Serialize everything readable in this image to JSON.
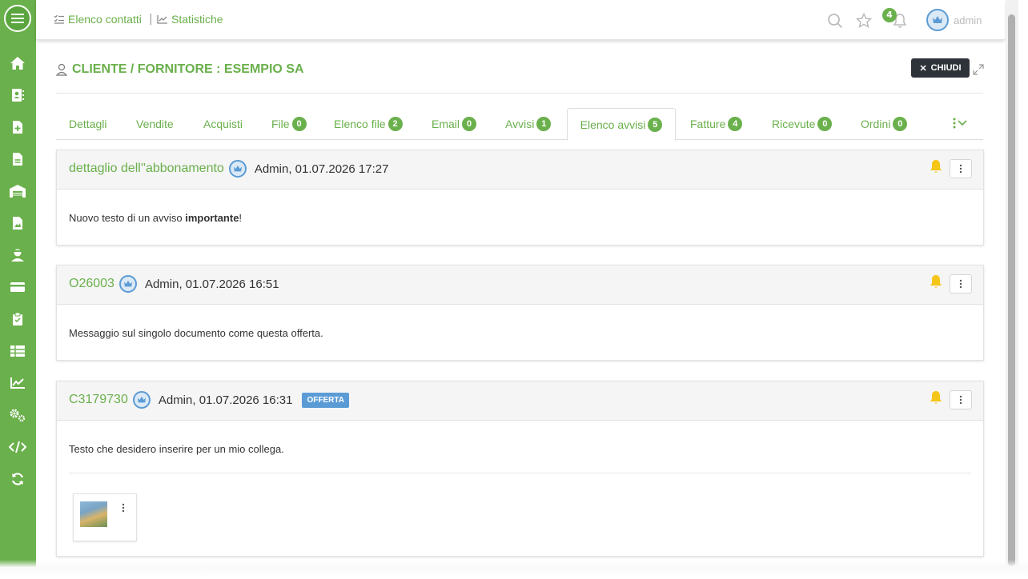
{
  "topbar": {
    "link_contacts": "Elenco contatti",
    "separator": "|",
    "link_stats": "Statistiche",
    "notification_count": "4",
    "user": "admin"
  },
  "page": {
    "title": "CLIENTE / FORNITORE : ESEMPIO SA",
    "close_label": "CHIUDI"
  },
  "tabs": [
    {
      "label": "Dettagli",
      "badge": ""
    },
    {
      "label": "Vendite",
      "badge": ""
    },
    {
      "label": "Acquisti",
      "badge": ""
    },
    {
      "label": "File",
      "badge": "0"
    },
    {
      "label": "Elenco file",
      "badge": "2"
    },
    {
      "label": "Email",
      "badge": "0"
    },
    {
      "label": "Avvisi",
      "badge": "1"
    },
    {
      "label": "Elenco avvisi",
      "badge": "5"
    },
    {
      "label": "Fatture",
      "badge": "4"
    },
    {
      "label": "Ricevute",
      "badge": "0"
    },
    {
      "label": "Ordini",
      "badge": "0"
    }
  ],
  "cards": [
    {
      "title": "dettaglio dell''abbonamento",
      "meta": "Admin, 01.07.2026 17:27",
      "body_prefix": "Nuovo testo di un avviso ",
      "body_bold": "importante",
      "body_suffix": "!"
    },
    {
      "title": "O26003",
      "meta": "Admin, 01.07.2026 16:51",
      "body": "Messaggio sul singolo documento come questa offerta."
    },
    {
      "title": "C3179730",
      "meta": "Admin, 01.07.2026 16:31",
      "tag": "OFFERTA",
      "body": "Testo che desidero inserire per un mio collega."
    }
  ],
  "colors": {
    "brand_green": "#6ab04c",
    "bell_yellow": "#f5c518",
    "tag_blue": "#5b9bd5",
    "dark_button": "#2d3338"
  },
  "icons": {
    "sidebar": [
      "home-icon",
      "contacts-icon",
      "new-document-icon",
      "document-icon",
      "warehouse-icon",
      "image-file-icon",
      "user-icon",
      "credit-card-icon",
      "clipboard-icon",
      "table-icon",
      "chart-icon",
      "settings-icon",
      "code-icon",
      "refresh-icon"
    ],
    "topbar": [
      "search-icon",
      "star-icon",
      "bell-icon"
    ]
  }
}
